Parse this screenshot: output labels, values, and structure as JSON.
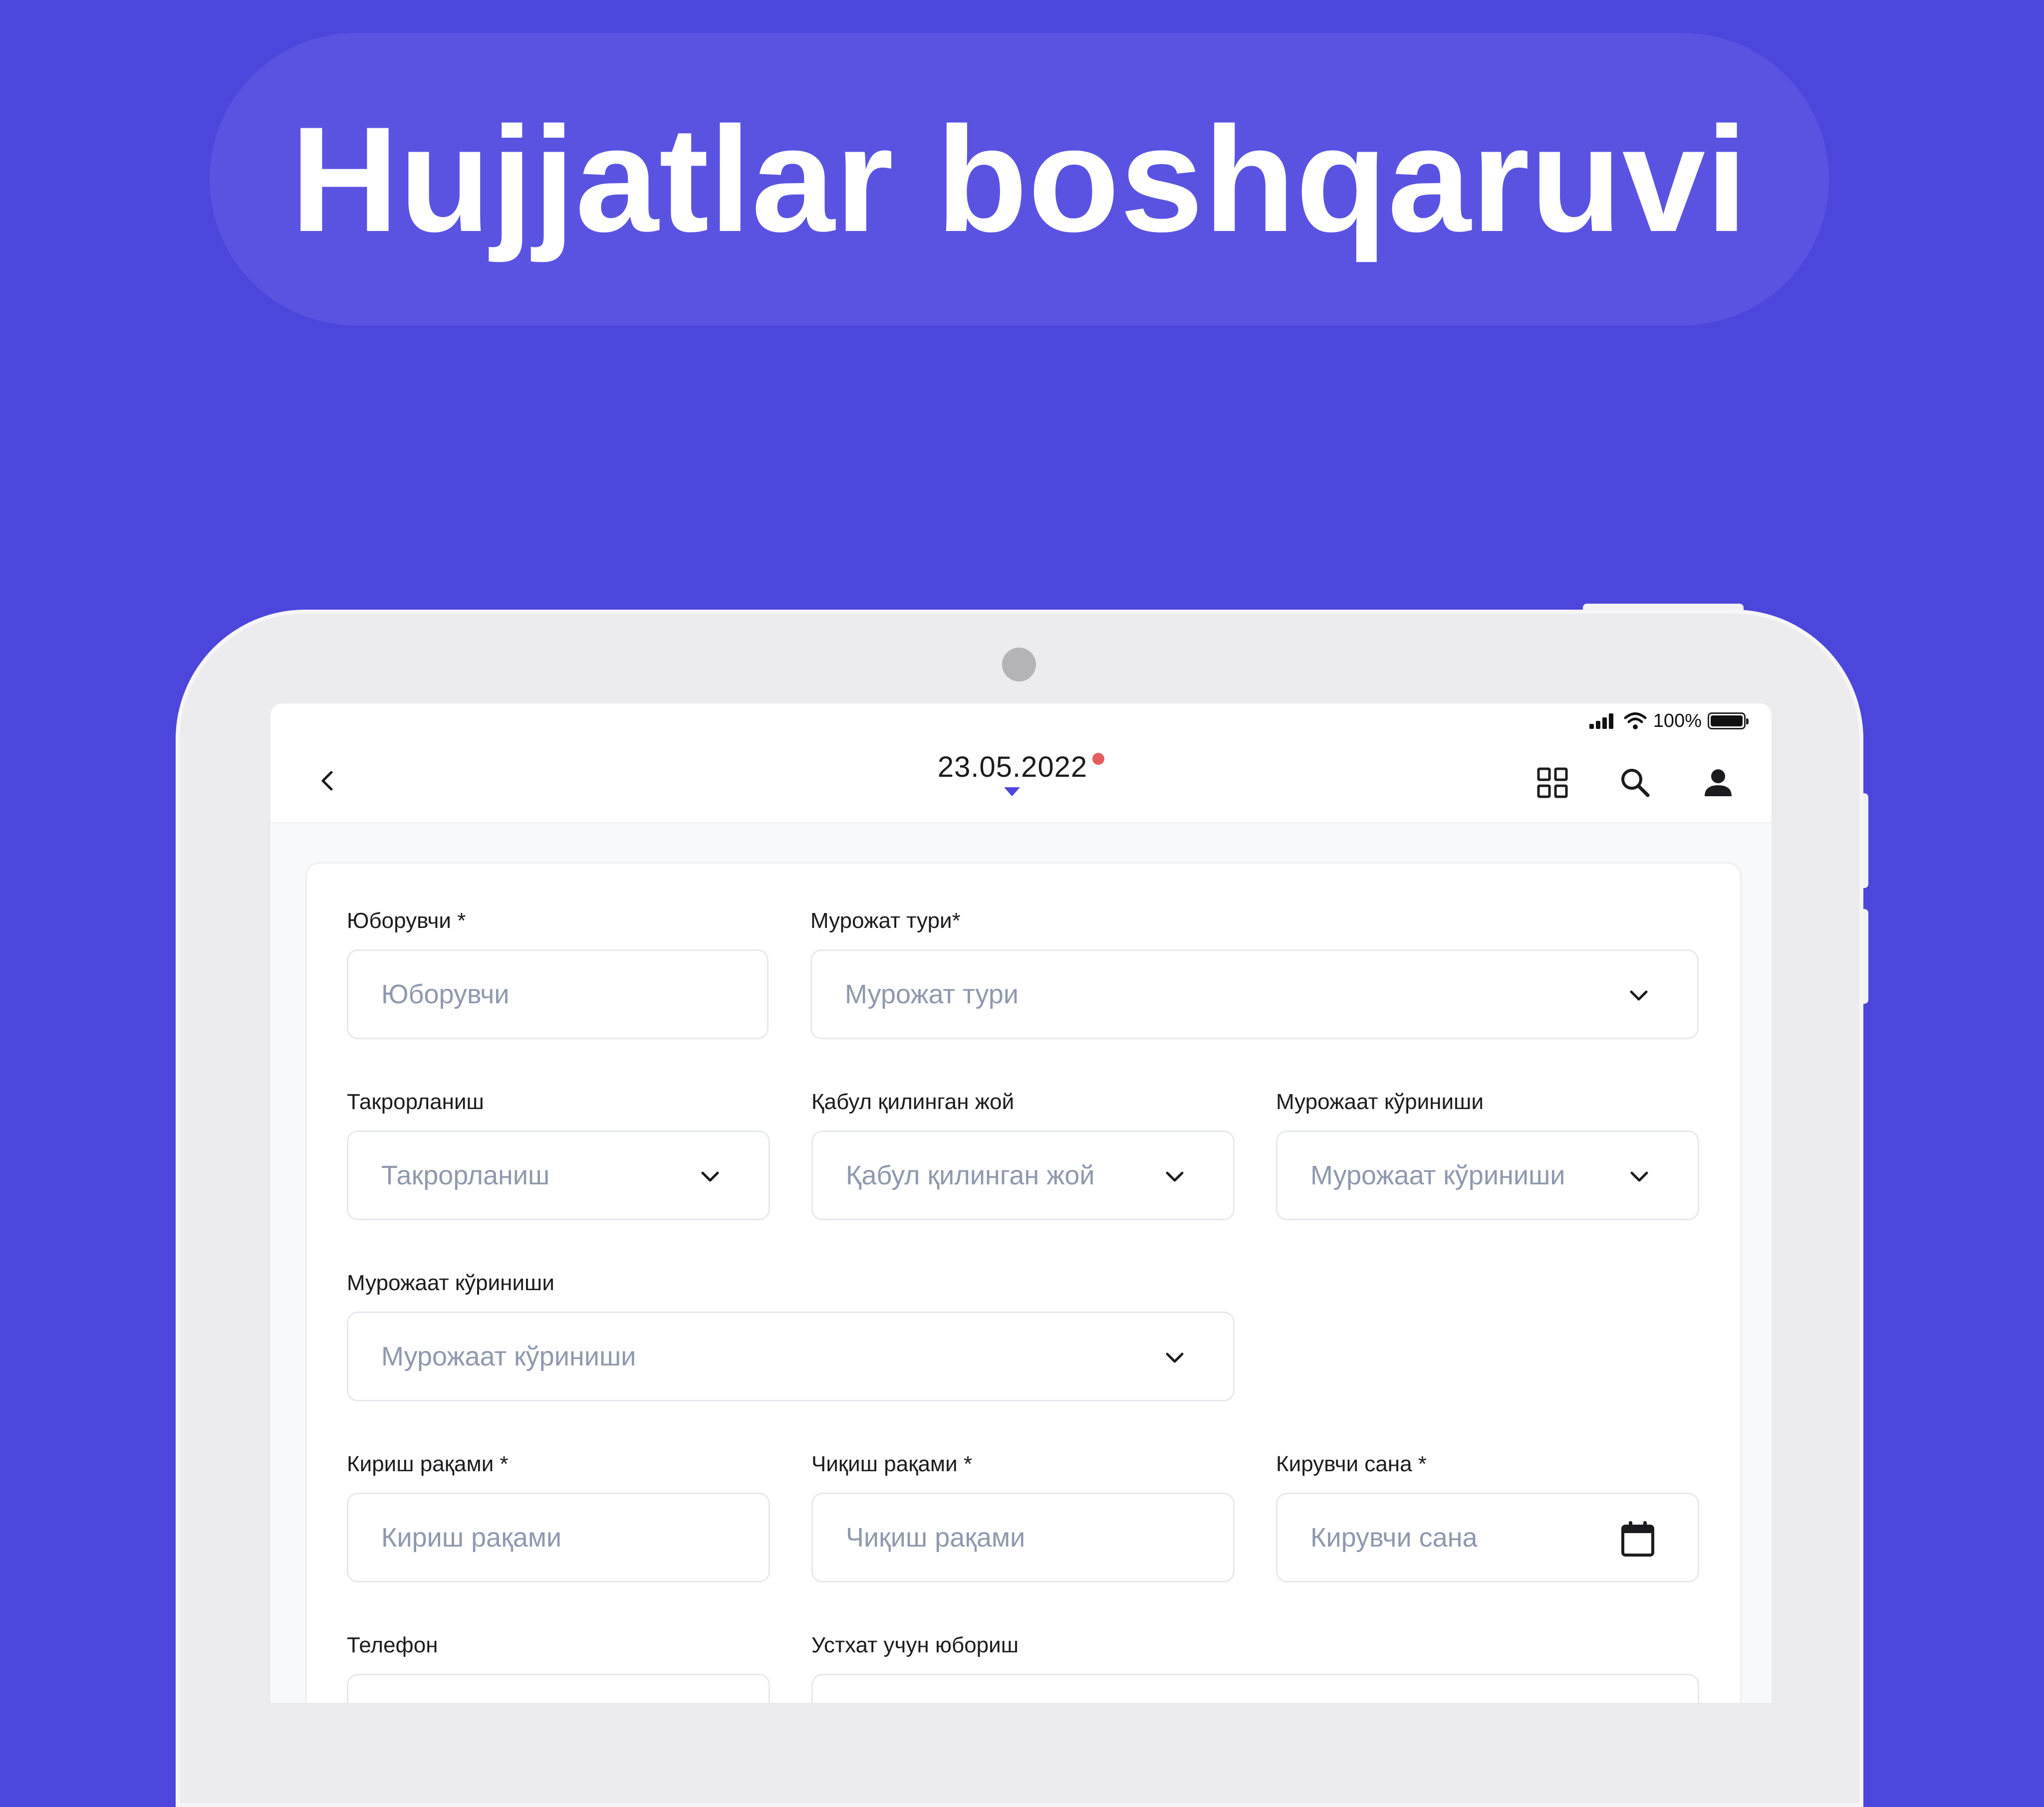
{
  "headline": "Hujjatlar boshqaruvi",
  "status_bar": {
    "battery": "100%"
  },
  "header": {
    "date": "23.05.2022"
  },
  "form": {
    "sender_label": "Юборувчи *",
    "sender_placeholder": "Юборувчи",
    "request_type_label": "Мурожат тури*",
    "request_type_placeholder": "Мурожат тури",
    "repeat_label": "Такрорланиш",
    "repeat_placeholder": "Такрорланиш",
    "received_place_label": "Қабул қилинган жой",
    "received_place_placeholder": "Қабул қилинган жой",
    "view_label": "Мурожаат кўриниши",
    "view_placeholder": "Мурожаат кўриниши",
    "view2_label": "Мурожаат кўриниши",
    "view2_placeholder": "Мурожаат кўриниши",
    "in_number_label": "Кириш рақами *",
    "in_number_placeholder": "Кириш рақами",
    "out_number_label": "Чиқиш рақами *",
    "out_number_placeholder": "Чиқиш рақами",
    "in_date_label": "Кирувчи сана *",
    "in_date_placeholder": "Кирувчи сана",
    "phone_label": "Телефон",
    "send_to_master_label": "Устхат учун юбориш"
  },
  "icons": [
    "chevron-left-icon",
    "grid-icon",
    "search-icon",
    "user-icon",
    "chevron-down-icon",
    "calendar-icon",
    "signal-icon",
    "wifi-icon",
    "battery-icon"
  ],
  "colors": {
    "background": "#4d46dc",
    "accent": "#4d46dc",
    "date_dot": "#e35d5b",
    "placeholder": "#8f98ad"
  }
}
